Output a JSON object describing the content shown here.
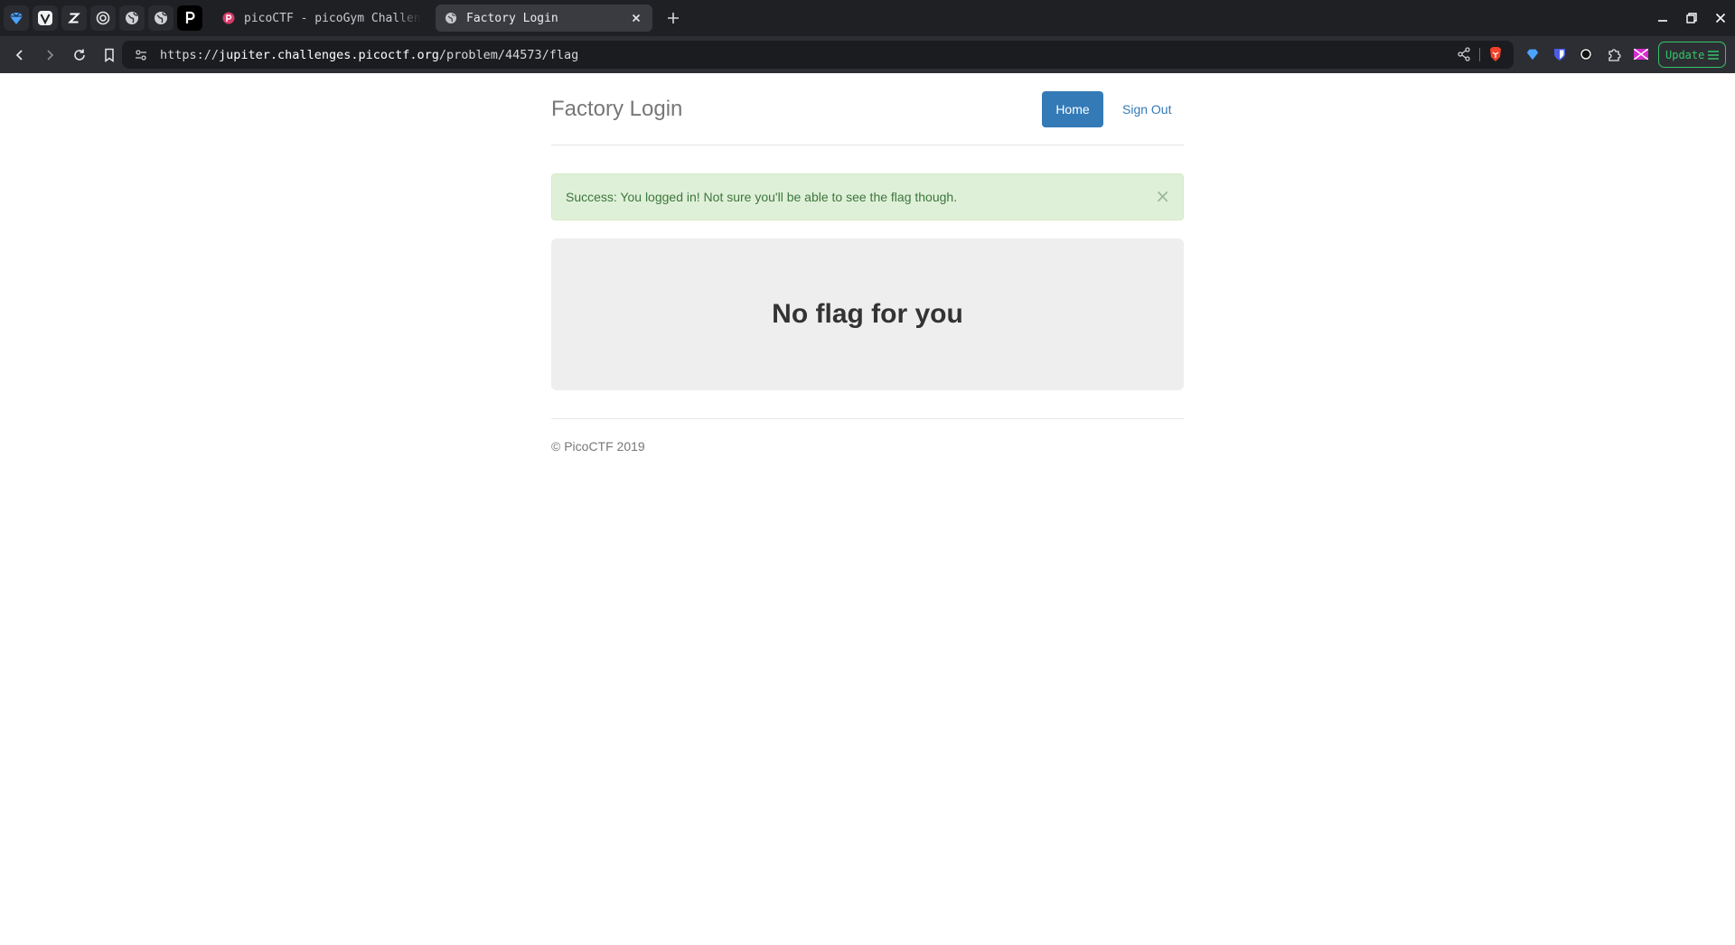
{
  "browser": {
    "pinned_tabs": [
      {
        "icon": "gem-icon"
      },
      {
        "icon": "v-logo-icon"
      },
      {
        "icon": "z-logo-icon"
      },
      {
        "icon": "openai-icon"
      },
      {
        "icon": "globe-icon"
      },
      {
        "icon": "globe-icon"
      },
      {
        "icon": "p-logo-icon"
      }
    ],
    "tabs": [
      {
        "title": "picoCTF - picoGym Challenges",
        "active": false,
        "icon": "picoctf-icon"
      },
      {
        "title": "Factory Login",
        "active": true,
        "icon": "globe-icon"
      }
    ],
    "url": {
      "prefix": "https://",
      "host": "jupiter.challenges.picoctf.org",
      "path": "/problem/44573/flag"
    },
    "update_label": "Update",
    "colors": {
      "update": "#35c46a",
      "tabbar": "#1f2024",
      "toolbar": "#2d2e33"
    }
  },
  "site": {
    "brand": "Factory Login",
    "nav": {
      "home": "Home",
      "sign_out": "Sign Out"
    },
    "alert": {
      "text": "Success: You logged in! Not sure you'll be able to see the flag though.",
      "close": "×"
    },
    "jumbotron": {
      "heading": "No flag for you"
    },
    "footer": {
      "copyright": "© PicoCTF 2019"
    },
    "colors": {
      "primary": "#337ab7",
      "success_bg": "#dff0d8",
      "success_text": "#3c763d",
      "jumbotron_bg": "#eeeeee"
    }
  }
}
